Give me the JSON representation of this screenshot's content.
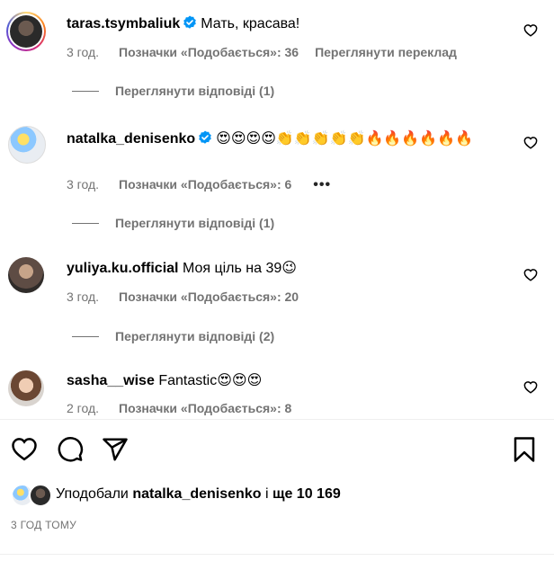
{
  "comments": [
    {
      "username": "taras.tsymbaliuk",
      "verified": true,
      "text": "Мать, красава!",
      "time": "3 год.",
      "likes": "Позначки «Подобається»: 36",
      "translate": "Переглянути переклад",
      "replies": "Переглянути відповіді (1)"
    },
    {
      "username": "natalka_denisenko",
      "verified": true,
      "text": "😍😍😍😍👏👏👏👏👏🔥🔥🔥🔥🔥🔥",
      "time": "3 год.",
      "likes": "Позначки «Подобається»: 6",
      "more": "•••",
      "replies": "Переглянути відповіді (1)"
    },
    {
      "username": "yuliya.ku.official",
      "verified": false,
      "text": "Моя ціль на 39😉",
      "time": "3 год.",
      "likes": "Позначки «Подобається»: 20",
      "replies": "Переглянути відповіді (2)"
    },
    {
      "username": "sasha__wise",
      "verified": false,
      "text": "Fantastic😍😍😍",
      "time": "2 год.",
      "likes": "Позначки «Подобається»: 8"
    }
  ],
  "likes_summary": {
    "prefix": "Уподобали",
    "user": "natalka_denisenko",
    "middle": "і",
    "others": "ще 10 169"
  },
  "time_ago": "3 ГОД ТОМУ",
  "icons": {
    "like": "heart-icon",
    "comment": "comment-icon",
    "share": "send-icon",
    "save": "bookmark-icon",
    "verified": "verified-badge-icon"
  },
  "colors": {
    "verified": "#0095f6",
    "meta_text": "#737373"
  }
}
